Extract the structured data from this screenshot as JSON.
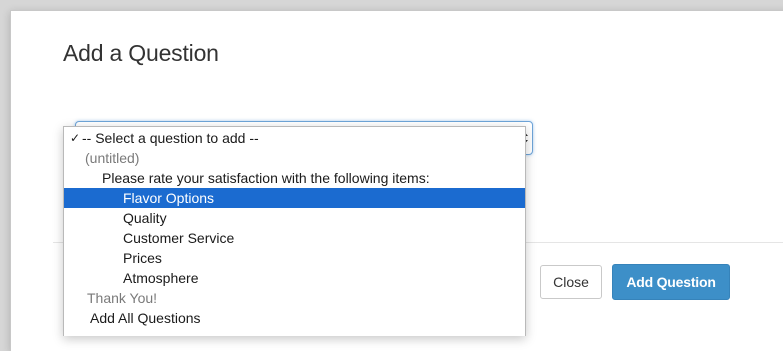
{
  "dialog": {
    "title": "Add a Question",
    "close_label": "Close",
    "add_label": "Add Question"
  },
  "dropdown": {
    "check_glyph": "✓",
    "options": [
      {
        "label": "-- Select a question to add --",
        "checked": true,
        "disabled": false
      },
      {
        "label": "(untitled)",
        "disabled": true
      },
      {
        "label": "Please rate your satisfaction with the following items:",
        "disabled": false
      },
      {
        "label": "Flavor Options",
        "selected": true,
        "disabled": false
      },
      {
        "label": "Quality",
        "disabled": false
      },
      {
        "label": "Customer Service",
        "disabled": false
      },
      {
        "label": "Prices",
        "disabled": false
      },
      {
        "label": "Atmosphere",
        "disabled": false
      },
      {
        "label": "Thank You!",
        "disabled": true
      },
      {
        "label": "Add All Questions",
        "disabled": false
      }
    ]
  },
  "colors": {
    "highlight": "#1b6bd0",
    "primary_button": "#3d8fc8"
  }
}
